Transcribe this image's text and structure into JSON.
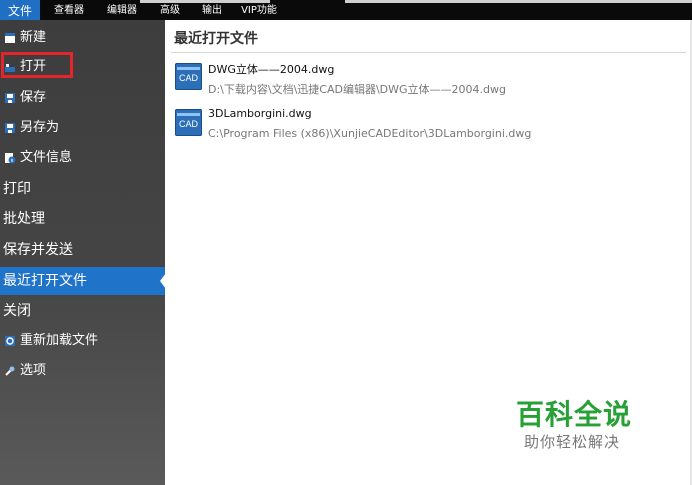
{
  "menubar": {
    "tabs": [
      {
        "label": "文件",
        "active": true
      },
      {
        "label": "查看器",
        "active": false
      },
      {
        "label": "编辑器",
        "active": false
      },
      {
        "label": "高级",
        "active": false
      },
      {
        "label": "输出",
        "active": false
      },
      {
        "label": "VIP功能",
        "active": false
      }
    ]
  },
  "sidebar": {
    "items": [
      {
        "label": "新建",
        "icon": "new-file-icon"
      },
      {
        "label": "打开",
        "icon": "open-folder-icon"
      },
      {
        "label": "保存",
        "icon": "save-icon"
      },
      {
        "label": "另存为",
        "icon": "save-as-icon"
      },
      {
        "label": "文件信息",
        "icon": "file-info-icon"
      },
      {
        "label": "打印",
        "icon": ""
      },
      {
        "label": "批处理",
        "icon": ""
      },
      {
        "label": "保存并发送",
        "icon": ""
      },
      {
        "label": "最近打开文件",
        "icon": "",
        "selected": true
      },
      {
        "label": "关闭",
        "icon": ""
      },
      {
        "label": "重新加载文件",
        "icon": "reload-icon"
      },
      {
        "label": "选项",
        "icon": "wrench-icon"
      }
    ]
  },
  "main": {
    "title": "最近打开文件",
    "recent_files": [
      {
        "name": "DWG立体——2004.dwg",
        "path": "D:\\下载内容\\文档\\迅捷CAD编辑器\\DWG立体——2004.dwg",
        "icon_text": "CAD"
      },
      {
        "name": "3DLamborgini.dwg",
        "path": "C:\\Program Files (x86)\\XunjieCADEditor\\3DLamborgini.dwg",
        "icon_text": "CAD"
      }
    ]
  },
  "watermark": {
    "title": "百科全说",
    "subtitle": "助你轻松解决"
  },
  "colors": {
    "accent": "#1f73c9",
    "highlight": "#e4262c",
    "watermark_green": "#27a035"
  }
}
